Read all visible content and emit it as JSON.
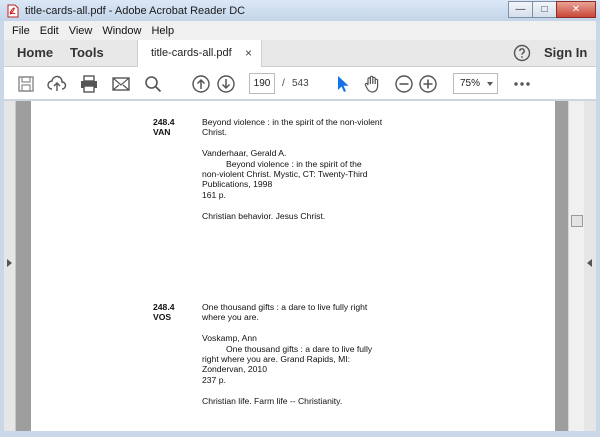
{
  "window": {
    "title": "title-cards-all.pdf - Adobe Acrobat Reader DC",
    "minimize": "—",
    "maximize": "□",
    "close": "✕"
  },
  "menu": [
    "File",
    "Edit",
    "View",
    "Window",
    "Help"
  ],
  "tabs": {
    "home": "Home",
    "tools": "Tools",
    "document": "title-cards-all.pdf",
    "close": "×",
    "sign_in": "Sign In"
  },
  "toolbar": {
    "current_page": "190",
    "page_separator": "/",
    "total_pages": "543",
    "zoom": "75%",
    "icons": [
      "save-icon",
      "upload-icon",
      "print-icon",
      "email-icon",
      "search-icon",
      "page-up-icon",
      "page-down-icon",
      "select-arrow-icon",
      "hand-icon",
      "zoom-out-icon",
      "zoom-in-icon",
      "more-icon"
    ]
  },
  "colors": {
    "accent": "#1473e6",
    "page_bg": "#ffffff",
    "canvas_bg": "#9e9e9e"
  },
  "cards": [
    {
      "call_line1": "248.4",
      "call_line2": "VAN",
      "title_line1": "Beyond violence : in the spirit of the non-violent",
      "title_line2": "Christ.",
      "author": "Vanderhaar, Gerald A.",
      "entry_line1": "Beyond violence : in the spirit of the",
      "entry_line2": "non-violent Christ. Mystic, CT: Twenty-Third",
      "entry_line3": "Publications, 1998",
      "pages": "161 p.",
      "subjects": "Christian behavior.   Jesus Christ."
    },
    {
      "call_line1": "248.4",
      "call_line2": "VOS",
      "title_line1": "One thousand gifts : a dare to live fully right",
      "title_line2": "where you are.",
      "author": "Voskamp, Ann",
      "entry_line1": "One thousand gifts : a dare to live fully",
      "entry_line2": "right where you are. Grand Rapids, MI:",
      "entry_line3": "Zondervan, 2010",
      "pages": "237 p.",
      "subjects": "Christian life.   Farm life -- Christianity."
    }
  ]
}
